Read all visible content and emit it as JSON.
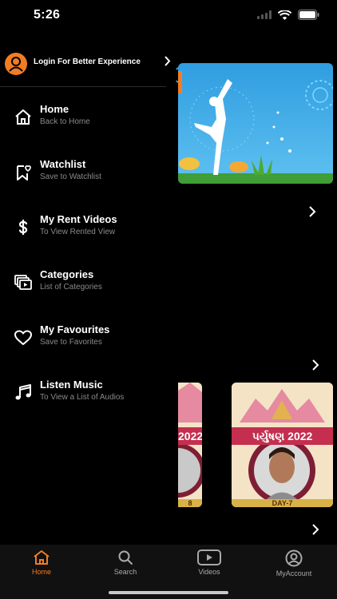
{
  "status_bar": {
    "time": "5:26"
  },
  "drawer": {
    "login_label": "Login For Better Experience",
    "items": [
      {
        "title": "Home",
        "subtitle": "Back to Home",
        "icon": "home-icon"
      },
      {
        "title": "Watchlist",
        "subtitle": "Save to Watchlist",
        "icon": "watchlist-icon"
      },
      {
        "title": "My Rent Videos",
        "subtitle": "To View Rented View",
        "icon": "dollar-icon"
      },
      {
        "title": "Categories",
        "subtitle": "List of Categories",
        "icon": "categories-icon"
      },
      {
        "title": "My Favourites",
        "subtitle": "Save to Favorites",
        "icon": "heart-icon"
      },
      {
        "title": "Listen Music",
        "subtitle": "To View a List of Audios",
        "icon": "music-icon"
      }
    ]
  },
  "content": {
    "thumb_1_text": "2022",
    "thumb_1_day": "8",
    "thumb_2_text": "પર્યુષણ 2022",
    "thumb_2_day": "DAY-7"
  },
  "tab_bar": {
    "tabs": [
      {
        "label": "Home",
        "icon": "home-tab-icon",
        "active": true
      },
      {
        "label": "Search",
        "icon": "search-icon",
        "active": false
      },
      {
        "label": "Videos",
        "icon": "videos-icon",
        "active": false
      },
      {
        "label": "MyAccount",
        "icon": "account-icon",
        "active": false
      }
    ]
  },
  "colors": {
    "accent": "#f07d25",
    "background": "#000000",
    "tab_bar": "#111111",
    "subtitle": "#8a8a8a"
  }
}
